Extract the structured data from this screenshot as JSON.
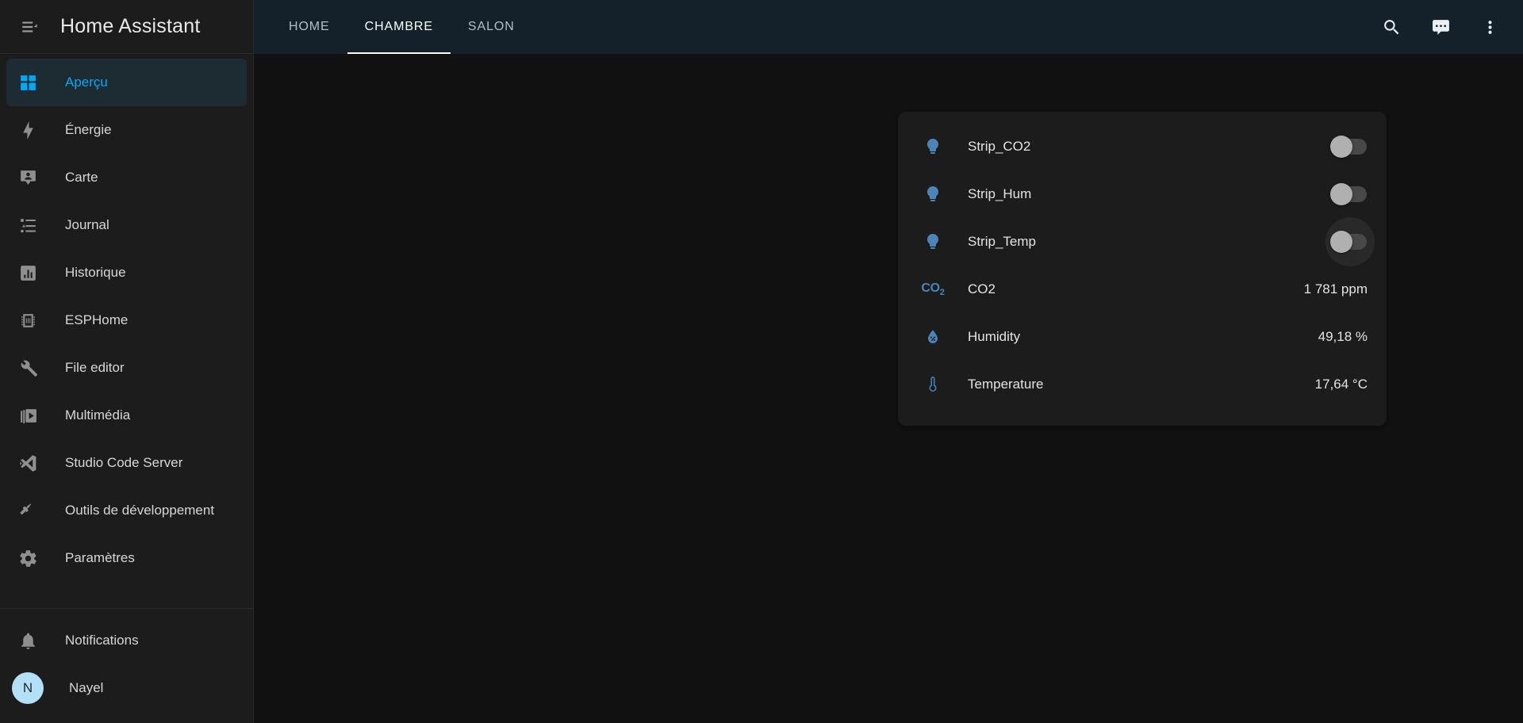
{
  "sidebar": {
    "title": "Home Assistant",
    "menu_icon": "menu-open-icon",
    "items": [
      {
        "label": "Aperçu",
        "icon": "view-dashboard-icon",
        "active": true
      },
      {
        "label": "Énergie",
        "icon": "lightning-bolt-icon",
        "active": false
      },
      {
        "label": "Carte",
        "icon": "map-marker-account-icon",
        "active": false
      },
      {
        "label": "Journal",
        "icon": "format-list-bulleted-type-icon",
        "active": false
      },
      {
        "label": "Historique",
        "icon": "chart-box-icon",
        "active": false
      },
      {
        "label": "ESPHome",
        "icon": "chip-icon",
        "active": false
      },
      {
        "label": "File editor",
        "icon": "wrench-icon",
        "active": false
      },
      {
        "label": "Multimédia",
        "icon": "multimedia-icon",
        "active": false
      },
      {
        "label": "Studio Code Server",
        "icon": "vscode-icon",
        "active": false
      },
      {
        "label": "Outils de développement",
        "icon": "hammer-icon",
        "active": false
      },
      {
        "label": "Paramètres",
        "icon": "cog-icon",
        "active": false
      }
    ],
    "footer": {
      "notifications_label": "Notifications",
      "notifications_icon": "bell-icon",
      "user_name": "Nayel",
      "user_initial": "N"
    }
  },
  "topbar": {
    "tabs": [
      {
        "label": "HOME",
        "active": false
      },
      {
        "label": "CHAMBRE",
        "active": true
      },
      {
        "label": "SALON",
        "active": false
      }
    ],
    "actions": [
      {
        "name": "search-icon",
        "label": "Rechercher"
      },
      {
        "name": "assist-icon",
        "label": "Assist"
      },
      {
        "name": "overflow-menu-icon",
        "label": "Menu"
      }
    ]
  },
  "card": {
    "rows": [
      {
        "kind": "toggle",
        "icon": "lightbulb-icon",
        "name": "Strip_CO2",
        "state": "off",
        "hovered": false
      },
      {
        "kind": "toggle",
        "icon": "lightbulb-icon",
        "name": "Strip_Hum",
        "state": "off",
        "hovered": false
      },
      {
        "kind": "toggle",
        "icon": "lightbulb-icon",
        "name": "Strip_Temp",
        "state": "off",
        "hovered": true
      },
      {
        "kind": "value",
        "icon": "co2-icon",
        "name": "CO2",
        "value": "1 781 ppm"
      },
      {
        "kind": "value",
        "icon": "water-percent-icon",
        "name": "Humidity",
        "value": "49,18 %"
      },
      {
        "kind": "value",
        "icon": "thermometer-icon",
        "name": "Temperature",
        "value": "17,64 °C"
      }
    ]
  },
  "colors": {
    "accent": "#03a9f4",
    "entity_icon": "#4b85b8",
    "page_background": "#111111",
    "card_background": "#1c1c1c",
    "topbar_background": "#14202a",
    "avatar_background": "#b3e0f7"
  }
}
